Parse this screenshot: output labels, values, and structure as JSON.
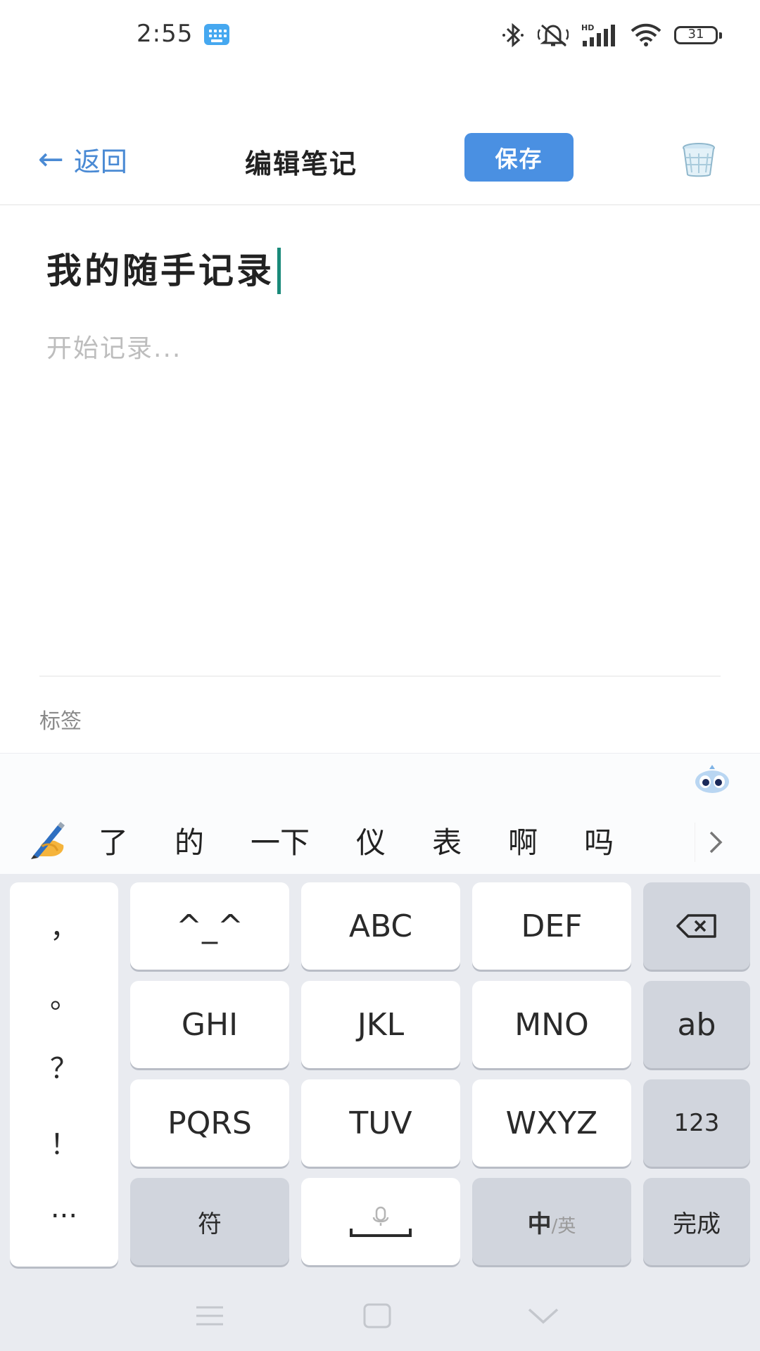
{
  "status_bar": {
    "time": "2:55",
    "battery": "31",
    "icons": [
      "bluetooth-icon",
      "mute-icon",
      "hd-signal-icon",
      "wifi-icon",
      "battery-icon"
    ]
  },
  "header": {
    "back_label": "返回",
    "title": "编辑笔记",
    "save_label": "保存",
    "accent_color": "#4a90e2"
  },
  "editor": {
    "title_value": "我的随手记录",
    "body_placeholder": "开始记录...",
    "tags_label": "标签"
  },
  "ime": {
    "candidates": [
      "了",
      "的",
      "一下",
      "仪",
      "表",
      "啊",
      "吗"
    ],
    "punctuation": [
      "，",
      "。",
      "？",
      "！",
      "..."
    ],
    "keys": {
      "emoticon": "^_^",
      "abc": "ABC",
      "def": "DEF",
      "ghi": "GHI",
      "jkl": "JKL",
      "mno": "MNO",
      "ab": "ab",
      "pqrs": "PQRS",
      "tuv": "TUV",
      "wxyz": "WXYZ",
      "num": "123",
      "symbol": "符",
      "zh": "中",
      "en": "/英",
      "done": "完成"
    }
  }
}
